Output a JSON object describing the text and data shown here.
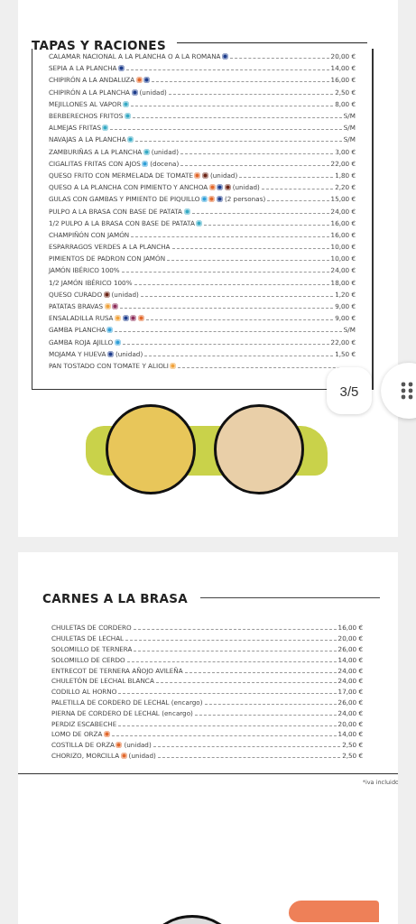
{
  "tapas": {
    "title": "TAPAS Y RACIONES",
    "items": [
      {
        "name": "CALAMAR NACIONAL A LA PLANCHA O A LA ROMANA",
        "allergens": [
          {
            "color": "#1d3c8c"
          }
        ],
        "price": "20,00 €"
      },
      {
        "name": "SEPIA A LA PLANCHA",
        "allergens": [
          {
            "color": "#1d3c8c"
          }
        ],
        "price": "14,00 €"
      },
      {
        "name": "CHIPIRÓN A LA ANDALUZA",
        "allergens": [
          {
            "color": "#e2672a"
          },
          {
            "color": "#1d3c8c"
          }
        ],
        "price": "16,00 €"
      },
      {
        "name": "CHIPIRÓN A LA PLANCHA",
        "allergens": [
          {
            "color": "#1d3c8c"
          }
        ],
        "note": "(unidad)",
        "price": "2,50 €"
      },
      {
        "name": "MEJILLONES AL VAPOR",
        "allergens": [
          {
            "color": "#35a9c4"
          }
        ],
        "price": "8,00 €"
      },
      {
        "name": "BERBERECHOS FRITOS",
        "allergens": [
          {
            "color": "#35a9c4"
          }
        ],
        "price": "S/M"
      },
      {
        "name": "ALMEJAS FRITAS",
        "allergens": [
          {
            "color": "#35a9c4"
          }
        ],
        "price": "S/M"
      },
      {
        "name": "NAVAJAS A LA PLANCHA",
        "allergens": [
          {
            "color": "#35a9c4"
          }
        ],
        "price": "S/M"
      },
      {
        "name": "ZAMBURIÑAS A LA PLANCHA",
        "allergens": [
          {
            "color": "#35a9c4"
          }
        ],
        "note": "(unidad)",
        "price": "3,00 €"
      },
      {
        "name": "CIGALITAS FRITAS CON AJOS",
        "allergens": [
          {
            "color": "#2f9fd8"
          }
        ],
        "note": "(docena)",
        "price": "22,00 €"
      },
      {
        "name": "QUESO FRITO CON MERMELADA DE TOMATE",
        "allergens": [
          {
            "color": "#e2672a"
          },
          {
            "color": "#6b2314"
          }
        ],
        "note": "(unidad)",
        "price": "1,80 €"
      },
      {
        "name": "QUESO A LA PLANCHA CON PIMIENTO Y ANCHOA",
        "allergens": [
          {
            "color": "#e2672a"
          },
          {
            "color": "#1d3c8c"
          },
          {
            "color": "#6b2314"
          }
        ],
        "note": "(unidad)",
        "price": "2,20 €"
      },
      {
        "name": "GULAS CON GAMBAS Y PIMIENTO DE PIQUILLO",
        "allergens": [
          {
            "color": "#2f9fd8"
          },
          {
            "color": "#e2672a"
          },
          {
            "color": "#1d3c8c"
          }
        ],
        "note": "(2 personas)",
        "price": "15,00 €"
      },
      {
        "name": "PULPO A LA BRASA CON BASE DE PATATA",
        "allergens": [
          {
            "color": "#35a9c4"
          }
        ],
        "price": "24,00 €"
      },
      {
        "name": "1/2 PULPO A LA BRASA CON BASE DE PATATA",
        "allergens": [
          {
            "color": "#35a9c4"
          }
        ],
        "price": "16,00 €"
      },
      {
        "name": "CHAMPIÑÓN CON JAMÓN",
        "price": "16,00 €"
      },
      {
        "name": "ESPARRAGOS VERDES A LA PLANCHA",
        "price": "10,00 €"
      },
      {
        "name": "PIMIENTOS DE PADRON CON JAMÓN",
        "price": "10,00 €"
      },
      {
        "name": "JAMÓN IBÉRICO 100%",
        "price": "24,00 €"
      },
      {
        "name": "1/2 JAMÓN IBÉRICO 100%",
        "price": "18,00 €"
      },
      {
        "name": "QUESO CURADO",
        "allergens": [
          {
            "color": "#6b2314"
          }
        ],
        "note": "(unidad)",
        "price": "1,20 €"
      },
      {
        "name": "PATATAS BRAVAS",
        "allergens": [
          {
            "color": "#f0a23a"
          },
          {
            "color": "#8c2d5a"
          }
        ],
        "price": "9,00 €"
      },
      {
        "name": "ENSALADILLA RUSA",
        "allergens": [
          {
            "color": "#f0a23a"
          },
          {
            "color": "#1d3c8c"
          },
          {
            "color": "#8c2d5a"
          },
          {
            "color": "#e2672a"
          }
        ],
        "price": "9,00 €"
      },
      {
        "name": "GAMBA PLANCHA",
        "allergens": [
          {
            "color": "#2f9fd8"
          }
        ],
        "price": "S/M"
      },
      {
        "name": "GAMBA ROJA AJILLO",
        "allergens": [
          {
            "color": "#2f9fd8"
          }
        ],
        "price": "22,00 €"
      },
      {
        "name": "MOJAMA Y HUEVA",
        "allergens": [
          {
            "color": "#1d3c8c"
          }
        ],
        "note": "(unidad)",
        "price": "1,50 €"
      },
      {
        "name": "PAN TOSTADO CON TOMATE Y ALIOLI",
        "allergens": [
          {
            "color": "#f0a23a"
          }
        ]
      }
    ]
  },
  "carnes": {
    "title": "CARNES A LA BRASA",
    "items": [
      {
        "name": "CHULETAS DE CORDERO",
        "price": "16,00 €"
      },
      {
        "name": "CHULETAS DE LECHAL",
        "price": "20,00 €"
      },
      {
        "name": "SOLOMILLO DE TERNERA",
        "price": "26,00 €"
      },
      {
        "name": "SOLOMILLO DE CERDO",
        "price": "14,00 €"
      },
      {
        "name": "ENTRECOT DE TERNERA AÑOJO AVILEÑA",
        "price": "24,00 €"
      },
      {
        "name": "CHULETÓN DE LECHAL BLANCA",
        "price": "24,00 €"
      },
      {
        "name": "CODILLO AL HORNO",
        "price": "17,00 €"
      },
      {
        "name": "PALETILLA DE CORDERO DE LECHAL (encargo)",
        "price": "26,00 €"
      },
      {
        "name": "PIERNA DE CORDERO DE LECHAL (encargo)",
        "price": "24,00 €"
      },
      {
        "name": "PERDIZ ESCABECHE",
        "price": "20,00 €"
      },
      {
        "name": "LOMO DE ORZA",
        "allergens": [
          {
            "color": "#e2672a"
          }
        ],
        "price": "14,00 €"
      },
      {
        "name": "COSTILLA DE ORZA",
        "allergens": [
          {
            "color": "#e2672a"
          }
        ],
        "note": "(unidad)",
        "price": "2,50 €"
      },
      {
        "name": "CHORIZO, MORCILLA",
        "allergens": [
          {
            "color": "#e2672a"
          }
        ],
        "note": "(unidad)",
        "price": "2,50 €"
      }
    ],
    "footnote": "*iva incluido"
  },
  "viewer": {
    "page_counter": "3/5"
  }
}
